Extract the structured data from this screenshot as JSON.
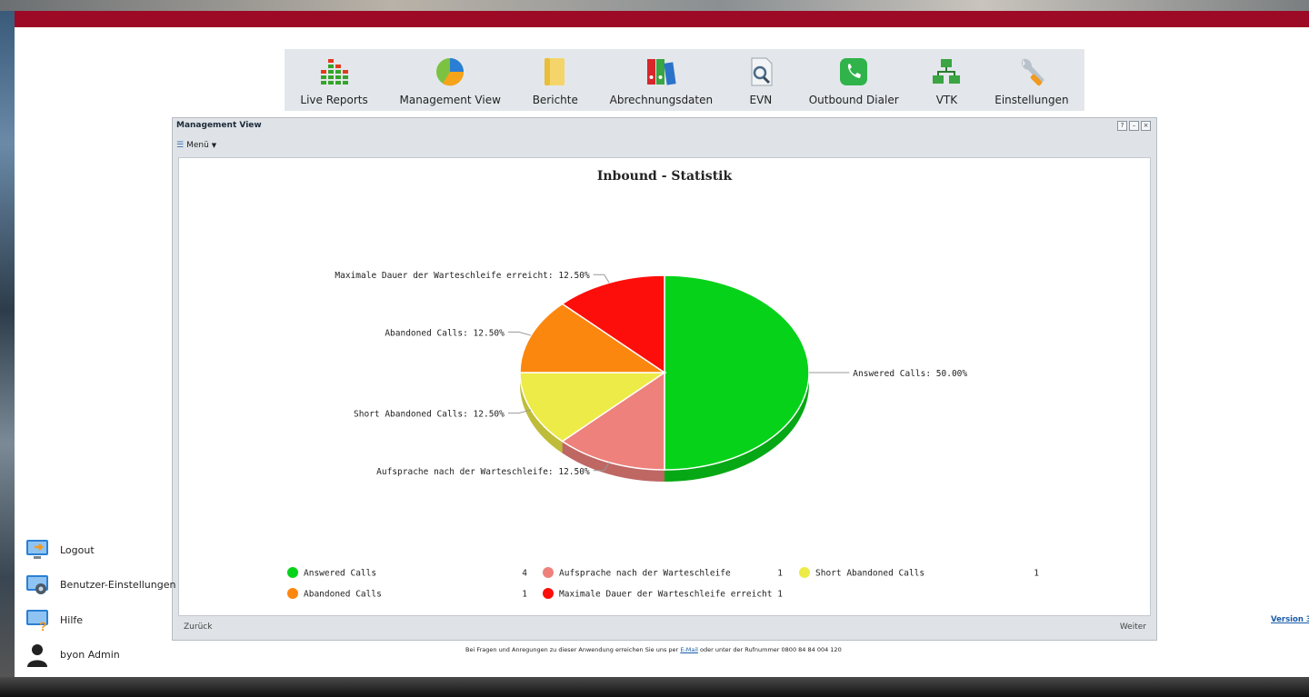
{
  "nav": {
    "items": [
      {
        "label": "Live Reports",
        "icon": "bar-chart-icon"
      },
      {
        "label": "Management View",
        "icon": "pie-chart-icon"
      },
      {
        "label": "Berichte",
        "icon": "folder-icon"
      },
      {
        "label": "Abrechnungsdaten",
        "icon": "binders-icon"
      },
      {
        "label": "EVN",
        "icon": "document-search-icon"
      },
      {
        "label": "Outbound Dialer",
        "icon": "phone-icon"
      },
      {
        "label": "VTK",
        "icon": "network-icon"
      },
      {
        "label": "Einstellungen",
        "icon": "wrench-icon"
      }
    ]
  },
  "panel": {
    "title": "Management View",
    "help_button": "?",
    "minimize_button": "–",
    "close_button": "×",
    "menu_label": "Menü",
    "back_label": "Zurück",
    "next_label": "Weiter"
  },
  "chart_data": {
    "type": "pie",
    "title": "Inbound - Statistik",
    "slices": [
      {
        "name": "Answered Calls",
        "value": 4,
        "label": "Answered Calls: 50.00%",
        "color": "#07d21a"
      },
      {
        "name": "Aufsprache nach der Warteschleife",
        "value": 1,
        "label": "Aufsprache nach der Warteschleife: 12.50%",
        "color": "#ee817c"
      },
      {
        "name": "Short Abandoned Calls",
        "value": 1,
        "label": "Short Abandoned Calls: 12.50%",
        "color": "#edeb47"
      },
      {
        "name": "Abandoned Calls",
        "value": 1,
        "label": "Abandoned Calls: 12.50%",
        "color": "#fc870f"
      },
      {
        "name": "Maximale Dauer der Warteschleife erreicht",
        "value": 1,
        "label": "Maximale Dauer der Warteschleife erreicht: 12.50%",
        "color": "#fd0e0a"
      }
    ],
    "legend_placement": "bottom"
  },
  "sidebar": {
    "items": [
      {
        "label": "Logout",
        "icon": "logout-icon"
      },
      {
        "label": "Benutzer-Einstellungen",
        "icon": "user-settings-icon"
      },
      {
        "label": "Hilfe",
        "icon": "help-icon"
      },
      {
        "label": "byon Admin",
        "icon": "user-icon"
      }
    ]
  },
  "footer": {
    "text_before": "Bei Fragen und Anregungen zu dieser Anwendung erreichen Sie uns per ",
    "link": "E-Mail",
    "text_after": " oder unter der Rufnummer 0800 84 84 004 120"
  },
  "version_label": "Version 3"
}
